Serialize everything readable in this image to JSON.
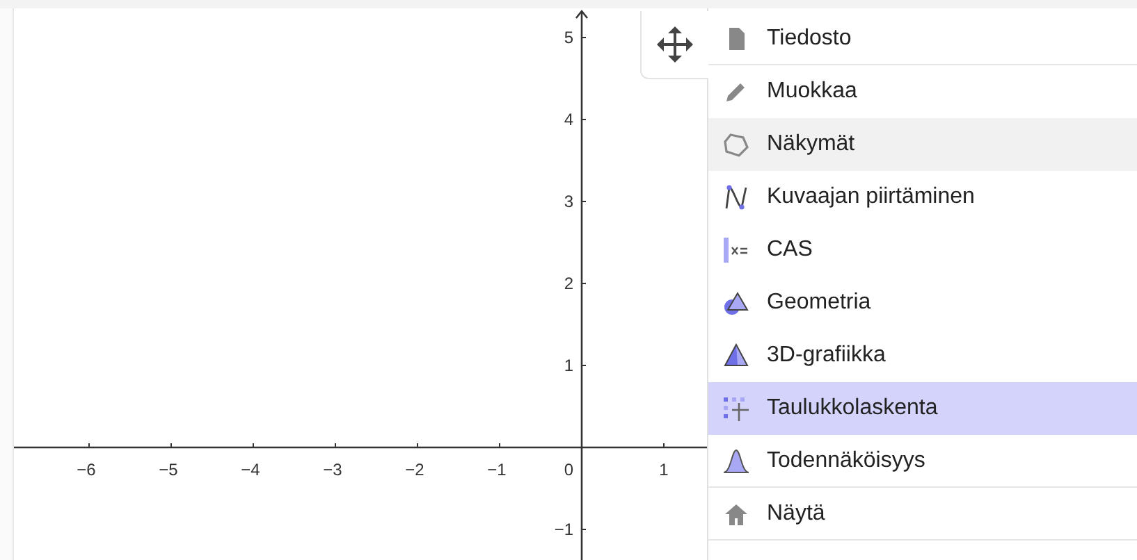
{
  "graphics_view": {
    "x_tick_labels": [
      "−6",
      "−5",
      "−4",
      "−3",
      "−2",
      "−1",
      "1"
    ],
    "origin_label": "0",
    "y_tick_labels": [
      "5",
      "4",
      "3",
      "2",
      "1",
      "−1"
    ]
  },
  "menu": {
    "items": [
      {
        "label": "Tiedosto",
        "selected": false,
        "hovered": false,
        "divider_after": true
      },
      {
        "label": "Muokkaa",
        "selected": false,
        "hovered": false,
        "divider_after": false
      },
      {
        "label": "Näkymät",
        "selected": false,
        "hovered": true,
        "divider_after": false
      },
      {
        "label": "Kuvaajan piirtäminen",
        "selected": false,
        "hovered": false,
        "divider_after": false
      },
      {
        "label": "CAS",
        "selected": false,
        "hovered": false,
        "divider_after": false
      },
      {
        "label": "Geometria",
        "selected": false,
        "hovered": false,
        "divider_after": false
      },
      {
        "label": "3D-grafiikka",
        "selected": false,
        "hovered": false,
        "divider_after": false
      },
      {
        "label": "Taulukkolaskenta",
        "selected": true,
        "hovered": false,
        "divider_after": false
      },
      {
        "label": "Todennäköisyys",
        "selected": false,
        "hovered": false,
        "divider_after": true
      },
      {
        "label": "Näytä",
        "selected": false,
        "hovered": false,
        "divider_after": true
      }
    ]
  }
}
